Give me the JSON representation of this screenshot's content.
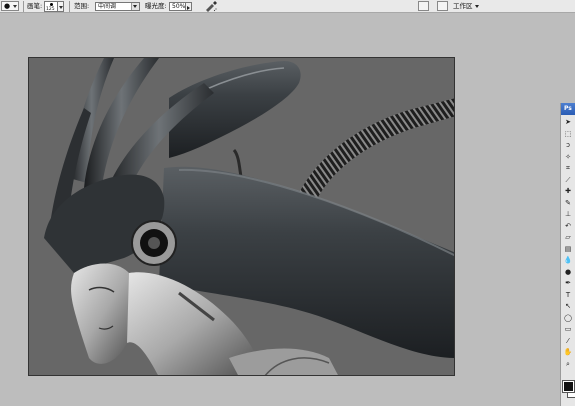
{
  "options_bar": {
    "tool_preset_icon": "dodge-tool-icon",
    "brush_label": "画笔:",
    "brush_size": "125",
    "range_label": "范围:",
    "range_value": "中间调",
    "exposure_label": "曝光度:",
    "exposure_value": "50%",
    "airbrush_icon": "airbrush-icon",
    "palette_well_icon": "palette-well-icon",
    "file_browser_icon": "file-browser-icon",
    "workspace_label": "工作区"
  },
  "toolbox": {
    "header": "Ps",
    "tools": [
      {
        "name": "move-tool-icon",
        "glyph": "➤"
      },
      {
        "name": "marquee-tool-icon",
        "glyph": "⬚"
      },
      {
        "name": "lasso-tool-icon",
        "glyph": "ↄ"
      },
      {
        "name": "magic-wand-tool-icon",
        "glyph": "✧"
      },
      {
        "name": "crop-tool-icon",
        "glyph": "⌗"
      },
      {
        "name": "slice-tool-icon",
        "glyph": "⟋"
      },
      {
        "name": "healing-brush-tool-icon",
        "glyph": "✚"
      },
      {
        "name": "brush-tool-icon",
        "glyph": "✎"
      },
      {
        "name": "clone-stamp-tool-icon",
        "glyph": "⊥"
      },
      {
        "name": "history-brush-tool-icon",
        "glyph": "↶"
      },
      {
        "name": "eraser-tool-icon",
        "glyph": "▱"
      },
      {
        "name": "gradient-tool-icon",
        "glyph": "▤"
      },
      {
        "name": "blur-tool-icon",
        "glyph": "💧"
      },
      {
        "name": "dodge-tool-icon",
        "glyph": "●"
      },
      {
        "name": "pen-tool-icon",
        "glyph": "✒"
      },
      {
        "name": "type-tool-icon",
        "glyph": "T"
      },
      {
        "name": "path-selection-tool-icon",
        "glyph": "↖"
      },
      {
        "name": "shape-tool-icon",
        "glyph": "◯"
      },
      {
        "name": "notes-tool-icon",
        "glyph": "▭"
      },
      {
        "name": "eyedropper-tool-icon",
        "glyph": "⁄"
      },
      {
        "name": "hand-tool-icon",
        "glyph": "✋"
      },
      {
        "name": "zoom-tool-icon",
        "glyph": "⌕"
      }
    ],
    "foreground_color": "#111111",
    "background_color": "#ffffff"
  },
  "document": {
    "canvas_bg": "#676767"
  }
}
